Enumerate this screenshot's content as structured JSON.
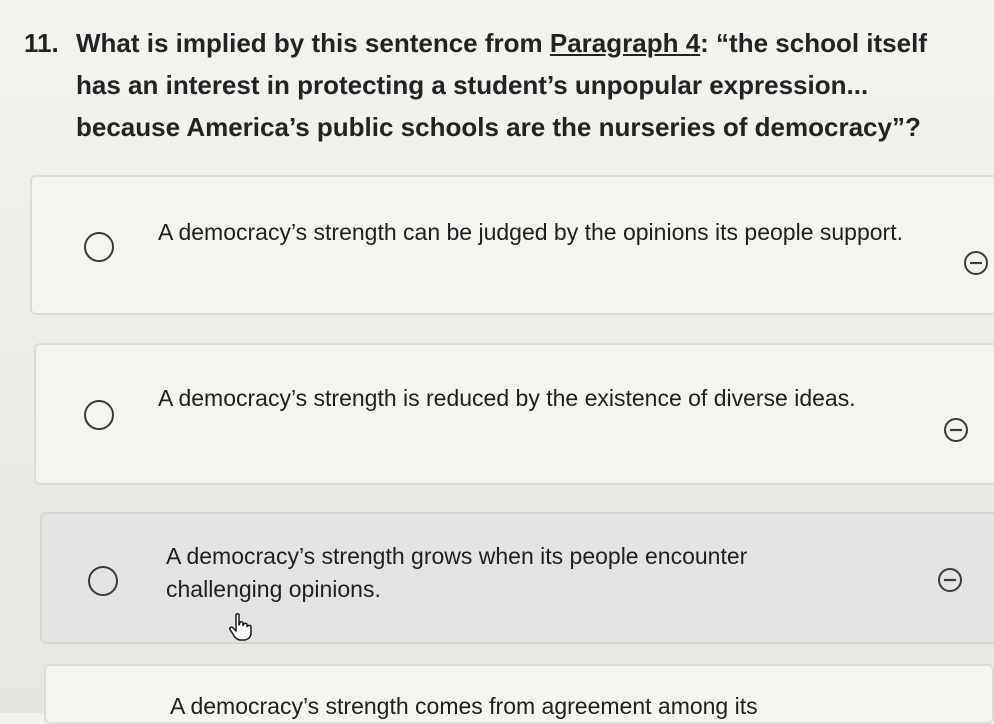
{
  "question": {
    "number": "11.",
    "text_before": "What is implied by this sentence from ",
    "reference": "Paragraph 4",
    "text_after": ": “the school itself has an interest in protecting a student’s unpopular expression... because America’s public schools are the nurseries of democracy”?"
  },
  "options": [
    {
      "text": "A democracy’s strength can be judged by the opinions its people support.",
      "eliminate_icon": "minus-circle-icon"
    },
    {
      "text": "A democracy’s strength is reduced by the existence of diverse ideas.",
      "eliminate_icon": "minus-circle-icon"
    },
    {
      "text": "A democracy’s strength grows when its people encounter challenging opinions.",
      "eliminate_icon": "minus-circle-icon"
    },
    {
      "text": "A democracy’s strength comes from agreement among its"
    }
  ],
  "cursor_icon": "hand-pointer-icon"
}
